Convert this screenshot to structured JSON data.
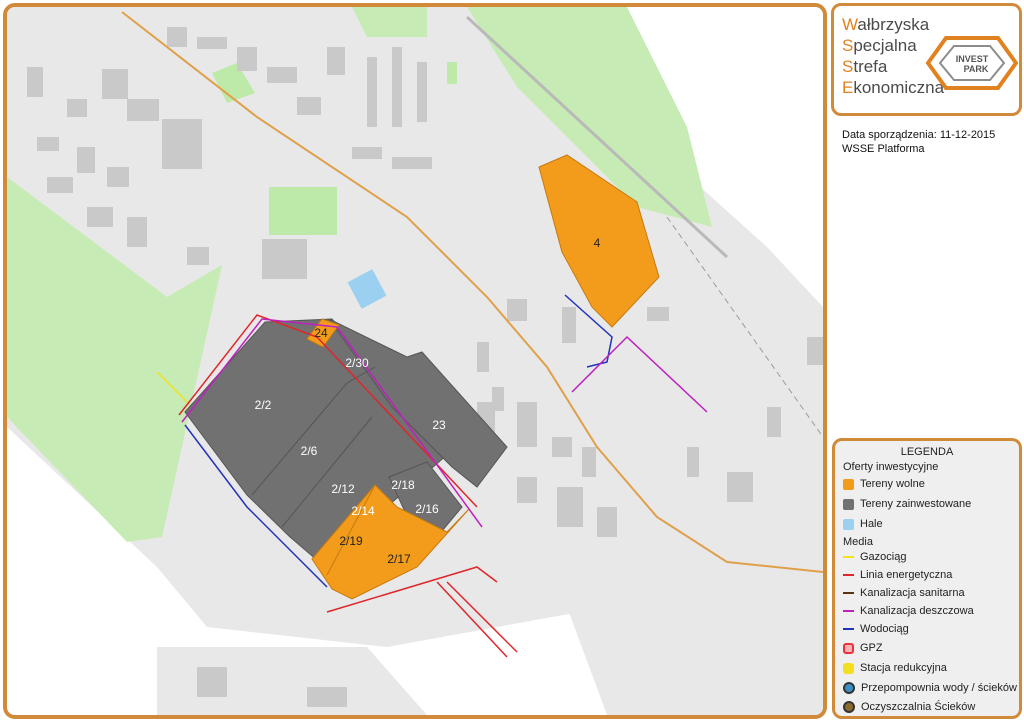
{
  "logo": {
    "lines": [
      {
        "initial": "W",
        "rest": "ałbrzyska"
      },
      {
        "initial": "S",
        "rest": "pecjalna"
      },
      {
        "initial": "S",
        "rest": "trefa"
      },
      {
        "initial": "E",
        "rest": "konomiczna"
      }
    ],
    "mark_line1": "INVEST",
    "mark_line2": "PARK"
  },
  "meta": {
    "date_line": "Data sporządzenia: 11-12-2015",
    "platform": "WSSE Platforma"
  },
  "parcels": [
    "4",
    "24",
    "2/30",
    "2/2",
    "23",
    "2/6",
    "2/12",
    "2/18",
    "2/14",
    "2/16",
    "2/19",
    "2/17"
  ],
  "legend": {
    "title": "LEGENDA",
    "group_offers": "Oferty inwestycyjne",
    "group_media": "Media",
    "items": [
      {
        "label": "Tereny wolne",
        "color": "#f39c1b"
      },
      {
        "label": "Tereny zainwestowane",
        "color": "#717171"
      },
      {
        "label": "Hale",
        "color": "#9cd0f0"
      },
      {
        "label": "Gazociąg",
        "color": "#f2e21a"
      },
      {
        "label": "Linia energetyczna",
        "color": "#e0262a"
      },
      {
        "label": "Kanalizacja sanitarna",
        "color": "#5a3410"
      },
      {
        "label": "Kanalizacja deszczowa",
        "color": "#c020c0"
      },
      {
        "label": "Wodociąg",
        "color": "#2233bb"
      },
      {
        "label": "GPZ",
        "color": "#e8333a"
      },
      {
        "label": "Stacja redukcyjna",
        "color": "#f3df20"
      },
      {
        "label": "Przepompownia wody / ścieków",
        "color": "#3a8fc4"
      },
      {
        "label": "Oczyszczalnia Ścieków",
        "color": "#8b6a2c"
      }
    ]
  },
  "colors": {
    "frame": "#d1893a",
    "free_land": "#f39c1b",
    "invested": "#717171",
    "greenery": "#c7ebb4",
    "land": "#e8e8e8",
    "building": "#c9c9c9",
    "road": "#e0a04a"
  }
}
